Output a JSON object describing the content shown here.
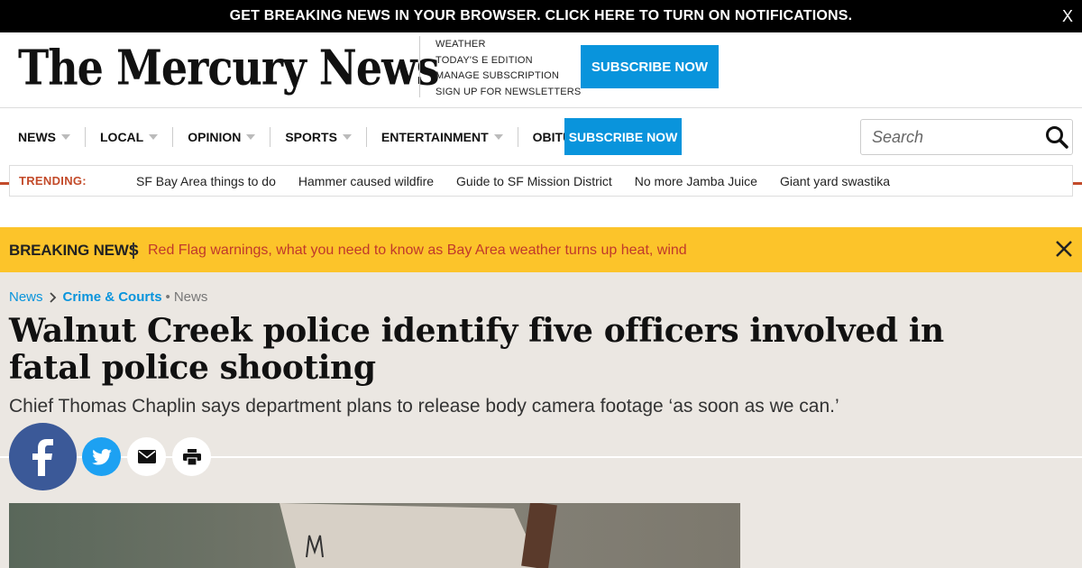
{
  "notification": {
    "text": "GET BREAKING NEWS IN YOUR BROWSER. CLICK HERE TO TURN ON NOTIFICATIONS.",
    "close_label": "X"
  },
  "masthead": {
    "logo": "The Mercury News",
    "links": [
      "WEATHER",
      "TODAY'S E EDITION",
      "MANAGE SUBSCRIPTION",
      "SIGN UP FOR NEWSLETTERS"
    ],
    "subscribe_label": "SUBSCRIBE NOW"
  },
  "nav": {
    "items": [
      "NEWS",
      "LOCAL",
      "OPINION",
      "SPORTS",
      "ENTERTAINMENT",
      "OBITUARIES"
    ],
    "subscribe_label": "SUBSCRIBE NOW",
    "search_placeholder": "Search"
  },
  "trending": {
    "label": "TRENDING:",
    "links": [
      "SF Bay Area things to do",
      "Hammer caused wildfire",
      "Guide to SF Mission District",
      "No more Jamba Juice",
      "Giant yard swastika"
    ]
  },
  "breaking": {
    "label": "BREAKING NEWS",
    "text": "Red Flag warnings, what you need to know as Bay Area weather turns up heat, wind"
  },
  "article": {
    "breadcrumb_root": "News",
    "breadcrumb_category": "Crime & Courts",
    "breadcrumb_dot": "•",
    "breadcrumb_section": "News",
    "headline": "Walnut Creek police identify five officers involved in fatal police shooting",
    "dek": "Chief Thomas Chaplin says department plans to release body camera footage ‘as soon as we can.’"
  },
  "colors": {
    "brand_blue": "#0994dc",
    "trending_red": "#c34b2a",
    "breaking_yellow": "#fcc42a",
    "facebook": "#3b5998",
    "twitter": "#1da1f2"
  },
  "icons": {
    "share": [
      "facebook-icon",
      "twitter-icon",
      "email-icon",
      "print-icon"
    ],
    "search": "search-icon",
    "close": "close-icon"
  }
}
